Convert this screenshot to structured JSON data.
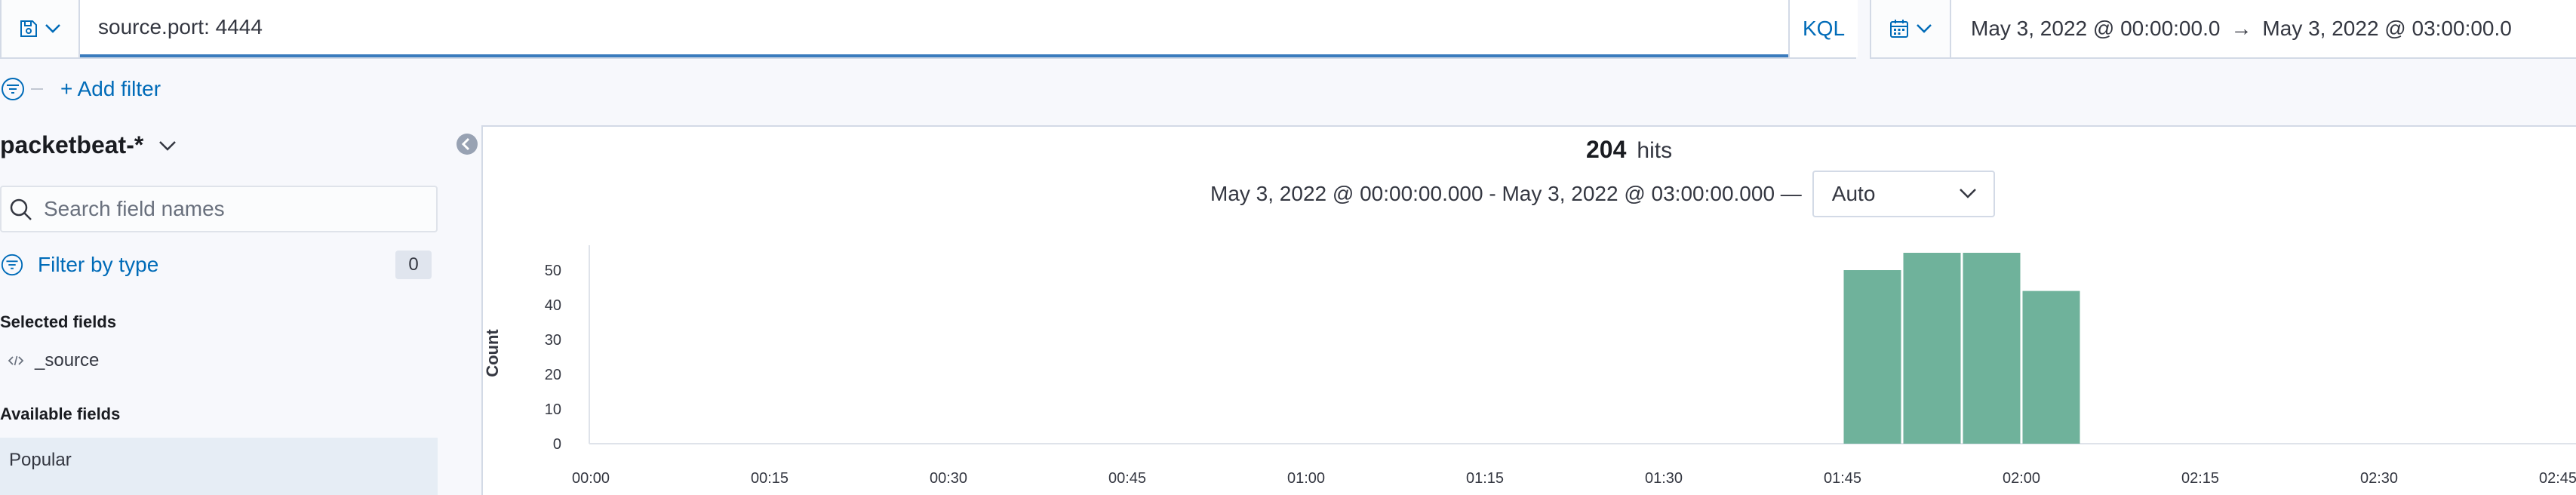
{
  "query_bar": {
    "query": "source.port: 4444",
    "language_button": "KQL"
  },
  "date_picker": {
    "start": "May 3, 2022 @ 00:00:00.0",
    "arrow": "→",
    "end": "May 3, 2022 @ 03:00:00.0"
  },
  "filter_row": {
    "add_filter": "+ Add filter"
  },
  "sidebar": {
    "index_pattern": "packetbeat-*",
    "search_placeholder": "Search field names",
    "filter_by_type": "Filter by type",
    "filter_count": "0",
    "selected_fields_title": "Selected fields",
    "selected_fields": [
      "_source"
    ],
    "available_fields_title": "Available fields",
    "popular_label": "Popular"
  },
  "main": {
    "hits_count": "204",
    "hits_label": "hits",
    "time_range": "May 3, 2022 @ 00:00:00.000 - May 3, 2022 @ 03:00:00.000 —",
    "interval": "Auto"
  },
  "colors": {
    "bar": "#6fb29b",
    "accent": "#006bb8",
    "query_underline": "#3a7bbd"
  },
  "chart_data": {
    "type": "bar",
    "ylabel": "Count",
    "xlabel": "",
    "y_ticks": [
      0,
      10,
      20,
      30,
      40,
      50
    ],
    "ylim": [
      0,
      55
    ],
    "x_ticks": [
      "00:00",
      "00:15",
      "00:30",
      "00:45",
      "01:00",
      "01:15",
      "01:30",
      "01:45",
      "02:00",
      "02:15",
      "02:30",
      "02:45"
    ],
    "x_range": [
      "00:00",
      "03:00"
    ],
    "bucket_minutes": 5,
    "buckets": [
      {
        "start": "01:45",
        "value": 50
      },
      {
        "start": "01:50",
        "value": 55
      },
      {
        "start": "01:55",
        "value": 55
      },
      {
        "start": "02:00",
        "value": 44
      }
    ],
    "grid": false
  }
}
